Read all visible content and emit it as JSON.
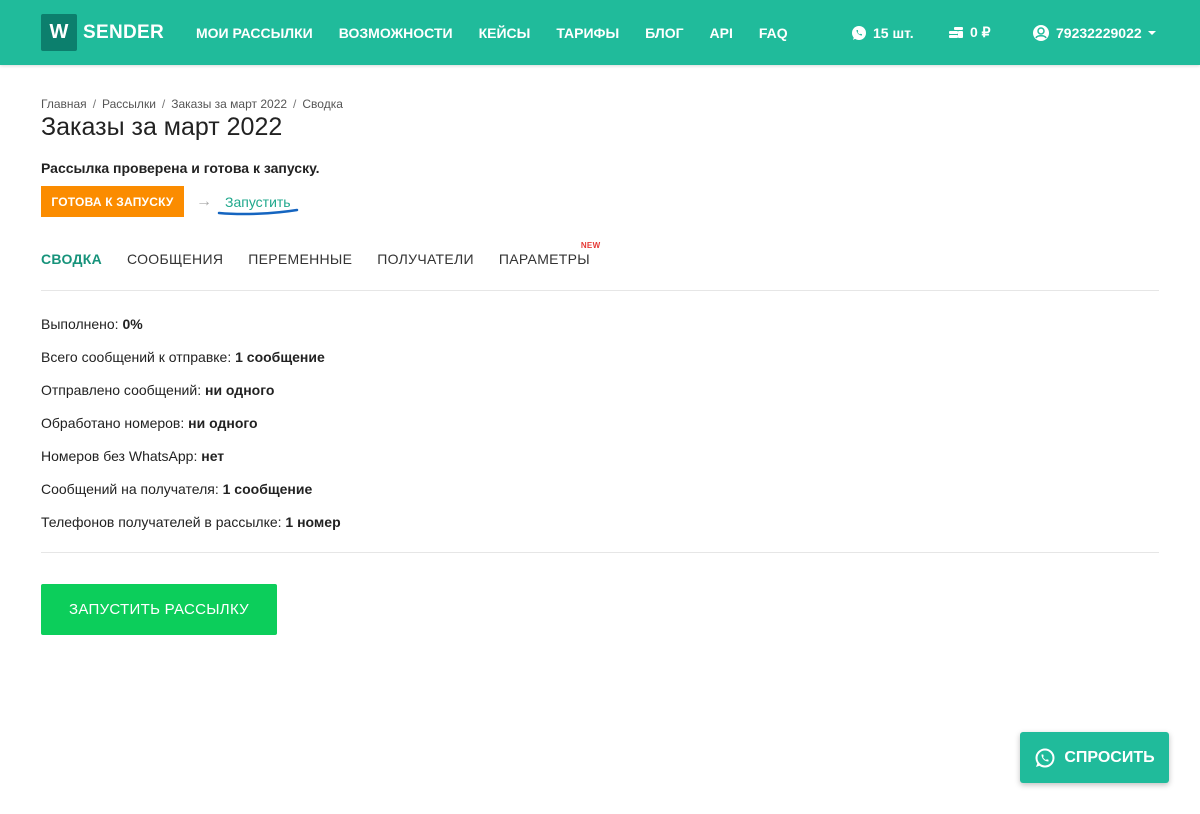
{
  "header": {
    "logo_letter": "W",
    "logo_text": "SENDER",
    "nav": [
      "МОИ РАССЫЛКИ",
      "ВОЗМОЖНОСТИ",
      "КЕЙСЫ",
      "ТАРИФЫ",
      "БЛОГ",
      "API",
      "FAQ"
    ],
    "whatsapp_count": "15 шт.",
    "balance": "0 ₽",
    "user_phone": "79232229022"
  },
  "breadcrumb": [
    "Главная",
    "Рассылки",
    "Заказы за март 2022",
    "Сводка"
  ],
  "page_title": "Заказы за март 2022",
  "status_text": "Рассылка проверена и готова к запуску.",
  "ready_badge": "ГОТОВА К ЗАПУСКУ",
  "launch_link": "Запустить",
  "tabs": [
    "СВОДКА",
    "СООБЩЕНИЯ",
    "ПЕРЕМЕННЫЕ",
    "ПОЛУЧАТЕЛИ",
    "ПАРАМЕТРЫ"
  ],
  "new_badge": "NEW",
  "stats": [
    {
      "label": "Выполнено: ",
      "value": "0%"
    },
    {
      "label": "Всего сообщений к отправке: ",
      "value": "1 сообщение"
    },
    {
      "label": "Отправлено сообщений: ",
      "value": "ни одного"
    },
    {
      "label": "Обработано номеров: ",
      "value": "ни одного"
    },
    {
      "label": "Номеров без WhatsApp: ",
      "value": "нет"
    },
    {
      "label": "Сообщений на получателя: ",
      "value": "1 сообщение"
    },
    {
      "label": "Телефонов получателей в рассылке: ",
      "value": "1 номер"
    }
  ],
  "start_button": "ЗАПУСТИТЬ РАССЫЛКУ",
  "ask_button": "СПРОСИТЬ",
  "colors": {
    "header": "#20bb9b",
    "accent": "#17937b",
    "ready": "#fb8c00",
    "start": "#0cce5b",
    "new": "#e53935"
  }
}
